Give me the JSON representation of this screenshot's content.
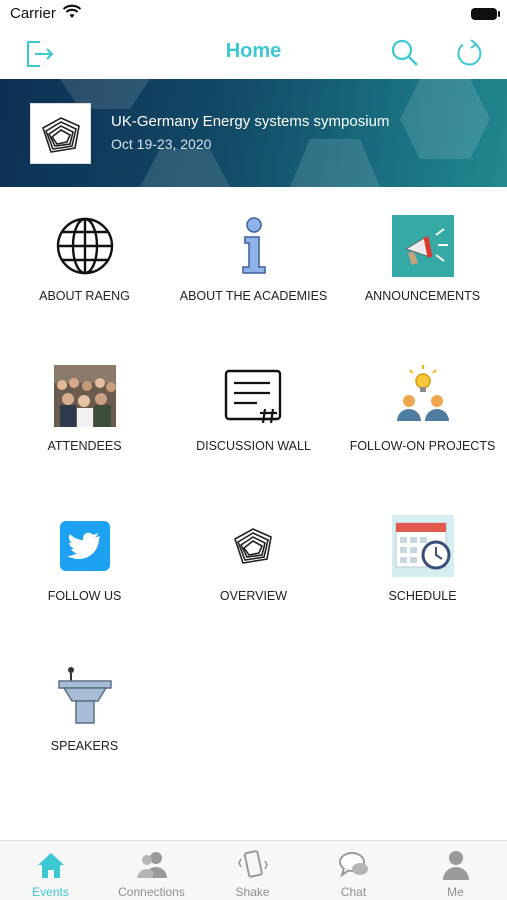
{
  "status_bar": {
    "carrier": "Carrier"
  },
  "nav": {
    "title": "Home"
  },
  "banner": {
    "title": "UK-Germany Energy systems symposium",
    "date": "Oct 19-23, 2020"
  },
  "tiles": [
    {
      "label": "ABOUT RAENG",
      "icon": "globe-icon"
    },
    {
      "label": "ABOUT THE ACADEMIES",
      "icon": "info-icon"
    },
    {
      "label": "ANNOUNCEMENTS",
      "icon": "megaphone-icon"
    },
    {
      "label": "ATTENDEES",
      "icon": "crowd-photo-icon"
    },
    {
      "label": "DISCUSSION WALL",
      "icon": "discussion-icon"
    },
    {
      "label": "FOLLOW-ON PROJECTS",
      "icon": "idea-people-icon"
    },
    {
      "label": "FOLLOW US",
      "icon": "twitter-icon"
    },
    {
      "label": "OVERVIEW",
      "icon": "symposium-logo-icon"
    },
    {
      "label": "SCHEDULE",
      "icon": "calendar-clock-icon"
    },
    {
      "label": "SPEAKERS",
      "icon": "podium-icon"
    }
  ],
  "tab_bar": {
    "tabs": [
      {
        "label": "Events",
        "active": true
      },
      {
        "label": "Connections",
        "active": false
      },
      {
        "label": "Shake",
        "active": false
      },
      {
        "label": "Chat",
        "active": false
      },
      {
        "label": "Me",
        "active": false
      }
    ]
  },
  "colors": {
    "accent": "#3cc8d2",
    "banner_dark": "#0c2f52",
    "banner_light": "#22888f"
  }
}
